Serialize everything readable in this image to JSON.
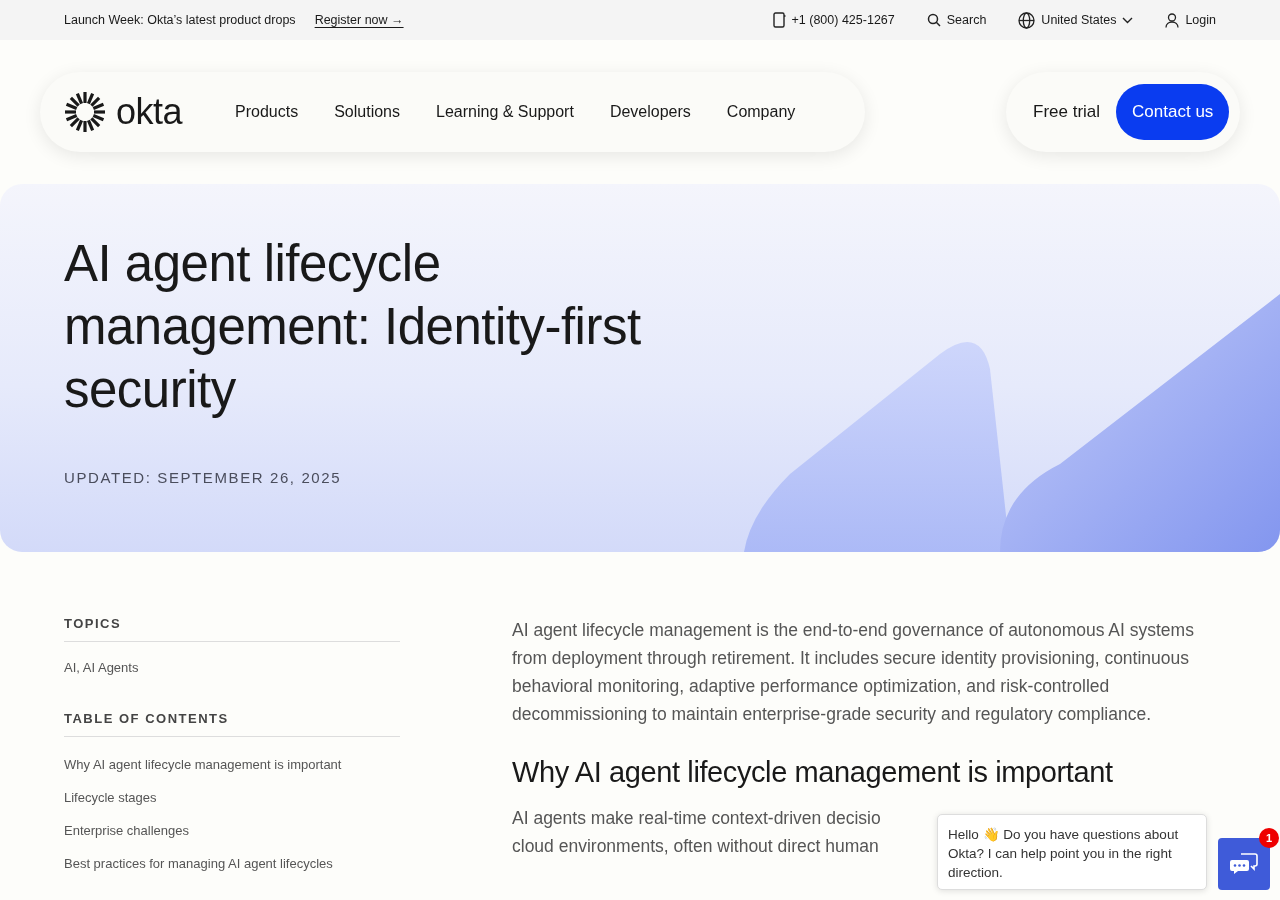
{
  "top_bar": {
    "announcement": "Launch Week: Okta’s latest product drops",
    "register_link": "Register now →",
    "phone": "+1 (800) 425-1267",
    "search": "Search",
    "region": "United States",
    "login": "Login"
  },
  "nav": {
    "brand": "okta",
    "items": [
      "Products",
      "Solutions",
      "Learning & Support",
      "Developers",
      "Company"
    ],
    "free_trial": "Free trial",
    "contact": "Contact us"
  },
  "hero": {
    "title": "AI agent lifecycle management: Identity-first security",
    "updated": "UPDATED: SEPTEMBER 26, 2025"
  },
  "sidebar": {
    "topics_heading": "TOPICS",
    "topics": "AI, AI Agents",
    "toc_heading": "TABLE OF CONTENTS",
    "toc": [
      "Why AI agent lifecycle management is important",
      "Lifecycle stages",
      "Enterprise challenges",
      "Best practices for managing AI agent lifecycles"
    ]
  },
  "article": {
    "intro": "AI agent lifecycle management is the end-to-end governance of autonomous AI systems from deployment through retirement. It includes secure identity provisioning, continuous behavioral monitoring, adaptive performance optimization, and risk-controlled decommissioning to maintain enterprise-grade security and regulatory compliance.",
    "heading": "Why AI agent lifecycle management is important",
    "paragraph_lines": [
      "AI agents make real-time context-driven decisio",
      "cloud environments, often without direct human"
    ]
  },
  "chat": {
    "message": "Hello 👋 Do you have questions about Okta? I can help point you in the right direction.",
    "badge": "1"
  }
}
